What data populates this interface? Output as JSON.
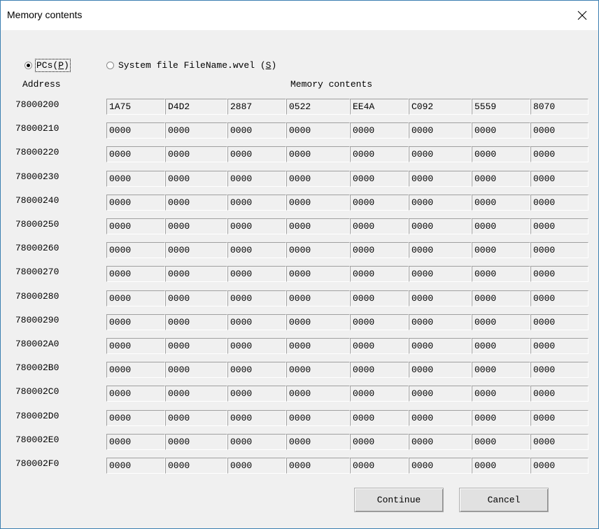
{
  "window": {
    "title": "Memory contents",
    "close_glyph": "✕"
  },
  "source": {
    "pcs": {
      "label": "PCs",
      "accel": "P",
      "selected": true
    },
    "system": {
      "label": "System file FileName.wvel",
      "accel": "S",
      "selected": false
    }
  },
  "headers": {
    "address": "Address",
    "contents": "Memory contents"
  },
  "rows": [
    {
      "address": "78000200",
      "values": [
        "1A75",
        "D4D2",
        "2887",
        "0522",
        "EE4A",
        "C092",
        "5559",
        "8070"
      ]
    },
    {
      "address": "78000210",
      "values": [
        "0000",
        "0000",
        "0000",
        "0000",
        "0000",
        "0000",
        "0000",
        "0000"
      ]
    },
    {
      "address": "78000220",
      "values": [
        "0000",
        "0000",
        "0000",
        "0000",
        "0000",
        "0000",
        "0000",
        "0000"
      ]
    },
    {
      "address": "78000230",
      "values": [
        "0000",
        "0000",
        "0000",
        "0000",
        "0000",
        "0000",
        "0000",
        "0000"
      ]
    },
    {
      "address": "78000240",
      "values": [
        "0000",
        "0000",
        "0000",
        "0000",
        "0000",
        "0000",
        "0000",
        "0000"
      ]
    },
    {
      "address": "78000250",
      "values": [
        "0000",
        "0000",
        "0000",
        "0000",
        "0000",
        "0000",
        "0000",
        "0000"
      ]
    },
    {
      "address": "78000260",
      "values": [
        "0000",
        "0000",
        "0000",
        "0000",
        "0000",
        "0000",
        "0000",
        "0000"
      ]
    },
    {
      "address": "78000270",
      "values": [
        "0000",
        "0000",
        "0000",
        "0000",
        "0000",
        "0000",
        "0000",
        "0000"
      ]
    },
    {
      "address": "78000280",
      "values": [
        "0000",
        "0000",
        "0000",
        "0000",
        "0000",
        "0000",
        "0000",
        "0000"
      ]
    },
    {
      "address": "78000290",
      "values": [
        "0000",
        "0000",
        "0000",
        "0000",
        "0000",
        "0000",
        "0000",
        "0000"
      ]
    },
    {
      "address": "780002A0",
      "values": [
        "0000",
        "0000",
        "0000",
        "0000",
        "0000",
        "0000",
        "0000",
        "0000"
      ]
    },
    {
      "address": "780002B0",
      "values": [
        "0000",
        "0000",
        "0000",
        "0000",
        "0000",
        "0000",
        "0000",
        "0000"
      ]
    },
    {
      "address": "780002C0",
      "values": [
        "0000",
        "0000",
        "0000",
        "0000",
        "0000",
        "0000",
        "0000",
        "0000"
      ]
    },
    {
      "address": "780002D0",
      "values": [
        "0000",
        "0000",
        "0000",
        "0000",
        "0000",
        "0000",
        "0000",
        "0000"
      ]
    },
    {
      "address": "780002E0",
      "values": [
        "0000",
        "0000",
        "0000",
        "0000",
        "0000",
        "0000",
        "0000",
        "0000"
      ]
    },
    {
      "address": "780002F0",
      "values": [
        "0000",
        "0000",
        "0000",
        "0000",
        "0000",
        "0000",
        "0000",
        "0000"
      ]
    }
  ],
  "buttons": {
    "continue": "Continue",
    "cancel": "Cancel"
  }
}
